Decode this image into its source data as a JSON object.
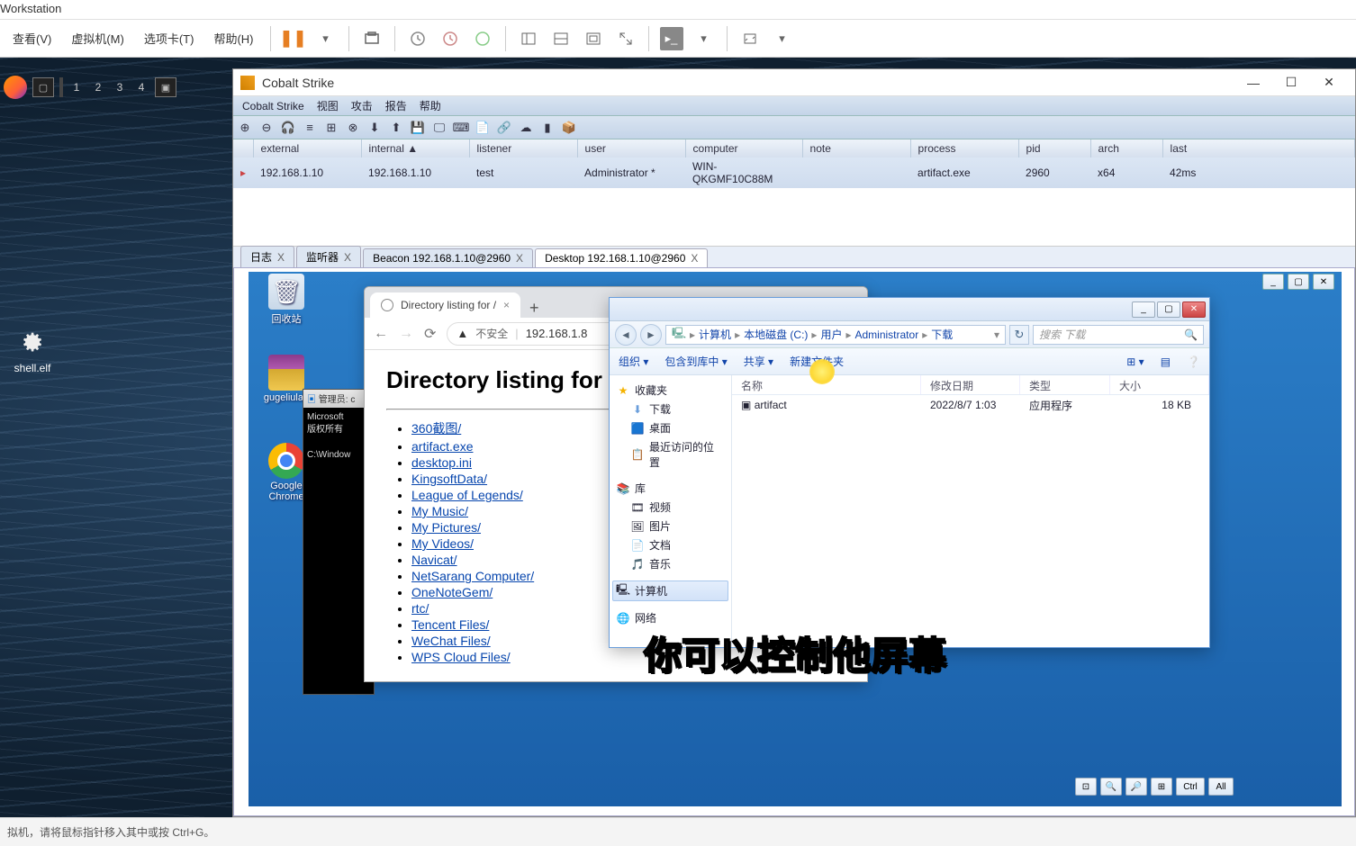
{
  "vm": {
    "title_suffix": " Workstation",
    "menu": [
      "查看(V)",
      "虚拟机(M)",
      "选项卡(T)",
      "帮助(H)"
    ],
    "taskbar_numbers": [
      "1",
      "2",
      "3",
      "4"
    ],
    "host_icon_label": "shell.elf",
    "status": "拟机，请将鼠标指针移入其中或按 Ctrl+G。"
  },
  "cs": {
    "title": "Cobalt Strike",
    "menu": [
      "Cobalt Strike",
      "视图",
      "攻击",
      "报告",
      "帮助"
    ],
    "columns": [
      "external",
      "internal ▲",
      "listener",
      "user",
      "computer",
      "note",
      "process",
      "pid",
      "arch",
      "last"
    ],
    "row": {
      "external": "192.168.1.10",
      "internal": "192.168.1.10",
      "listener": "test",
      "user": "Administrator *",
      "computer": "WIN-QKGMF10C88M",
      "note": "",
      "process": "artifact.exe",
      "pid": "2960",
      "arch": "x64",
      "last": "42ms"
    },
    "tabs": [
      {
        "label": "日志",
        "close": "X"
      },
      {
        "label": "监听器",
        "close": "X"
      },
      {
        "label": "Beacon 192.168.1.10@2960",
        "close": "X"
      },
      {
        "label": "Desktop 192.168.1.10@2960",
        "close": "X"
      }
    ]
  },
  "remote": {
    "icons": {
      "recycle": "回收站",
      "winrar": "gugeliulan",
      "chrome": "Google\nChrome"
    },
    "cmd": {
      "title": "管理员: c",
      "line1": "Microsoft",
      "line2": "版权所有",
      "line3": "C:\\Window"
    }
  },
  "browser": {
    "tab_title": "Directory listing for /",
    "insecure": "不安全",
    "url": "192.168.1.8",
    "heading": "Directory listing for",
    "links": [
      "360截图/",
      "artifact.exe",
      "desktop.ini",
      "KingsoftData/",
      "League of Legends/",
      "My Music/",
      "My Pictures/",
      "My Videos/",
      "Navicat/",
      "NetSarang Computer/",
      "OneNoteGem/",
      "rtc/",
      "Tencent Files/",
      "WeChat Files/",
      "WPS Cloud Files/"
    ]
  },
  "explorer": {
    "breadcrumb": [
      "计算机",
      "本地磁盘 (C:)",
      "用户",
      "Administrator",
      "下载"
    ],
    "search_placeholder": "搜索 下载",
    "toolbar": {
      "organize": "组织 ▾",
      "include": "包含到库中 ▾",
      "share": "共享 ▾",
      "newfolder": "新建文件夹"
    },
    "sidebar": {
      "favorites": "收藏夹",
      "fav_items": [
        "下载",
        "桌面",
        "最近访问的位置"
      ],
      "library": "库",
      "lib_items": [
        "视频",
        "图片",
        "文档",
        "音乐"
      ],
      "computer": "计算机",
      "network": "网络"
    },
    "columns": {
      "name": "名称",
      "date": "修改日期",
      "type": "类型",
      "size": "大小"
    },
    "file": {
      "name": "artifact",
      "date": "2022/8/7 1:03",
      "type": "应用程序",
      "size": "18 KB"
    }
  },
  "zoom_labels": [
    "Ctrl",
    "All"
  ],
  "subtitle": "你可以控制他屏幕"
}
